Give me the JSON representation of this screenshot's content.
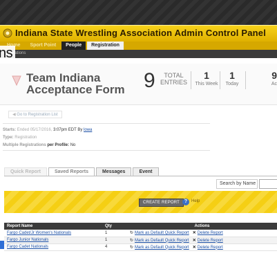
{
  "app": {
    "title": "Indiana State Wrestling Association Admin Control Panel"
  },
  "nav": {
    "items": [
      "Home",
      "Sport Point",
      "People",
      "Registration"
    ]
  },
  "subnav": {
    "label": "Operations"
  },
  "overlay": {
    "text": "ns"
  },
  "form": {
    "title": "Team Indiana Acceptance Form",
    "stats": {
      "total_value": "9",
      "total_label_line1": "TOTAL",
      "total_label_line2": "ENTRIES",
      "week_value": "1",
      "week_label": "This Week",
      "today_value": "1",
      "today_label": "Today",
      "partial_value": "9",
      "partial_label": "Ac"
    }
  },
  "back_link": {
    "label": "Go to Registration List"
  },
  "info": {
    "starts_label": "Starts:",
    "starts_value_faded": "Ended 05/17/2016,",
    "starts_value": "3:07pm EDT By",
    "starts_by": "lowa",
    "type_label": "Type:",
    "type_value": "Registration",
    "multi_label": "Multiple Registrations",
    "multi_label_tail": "per Profile:",
    "multi_value": "No"
  },
  "tabs": [
    "Quick Report",
    "Saved Reports",
    "Messages",
    "Event"
  ],
  "search": {
    "label": "Search by Name",
    "value": ""
  },
  "actions": {
    "create_label": "CREATE REPORT",
    "help_label": "Help",
    "help_icon": "?"
  },
  "table": {
    "columns": [
      "Report Name",
      "Qty",
      "Actions"
    ],
    "rows": [
      {
        "name": "Fargo Cadet/Jr Women's Nationals",
        "qty": "1",
        "mark": "Mark as Default Quick Report",
        "delete": "Delete Report"
      },
      {
        "name": "Fargo Junior Nationals",
        "qty": "1",
        "mark": "Mark as Default Quick Report",
        "delete": "Delete Report"
      },
      {
        "name": "Fargo Cadet Nationals",
        "qty": "4",
        "mark": "Mark as Default Quick Report",
        "delete": "Delete Report"
      }
    ],
    "icons": {
      "mark": "refresh-icon",
      "delete": "x-icon"
    }
  },
  "colors": {
    "accent": "#f5cf14",
    "dark": "#2a2a2a",
    "link": "#1b4fa5"
  }
}
